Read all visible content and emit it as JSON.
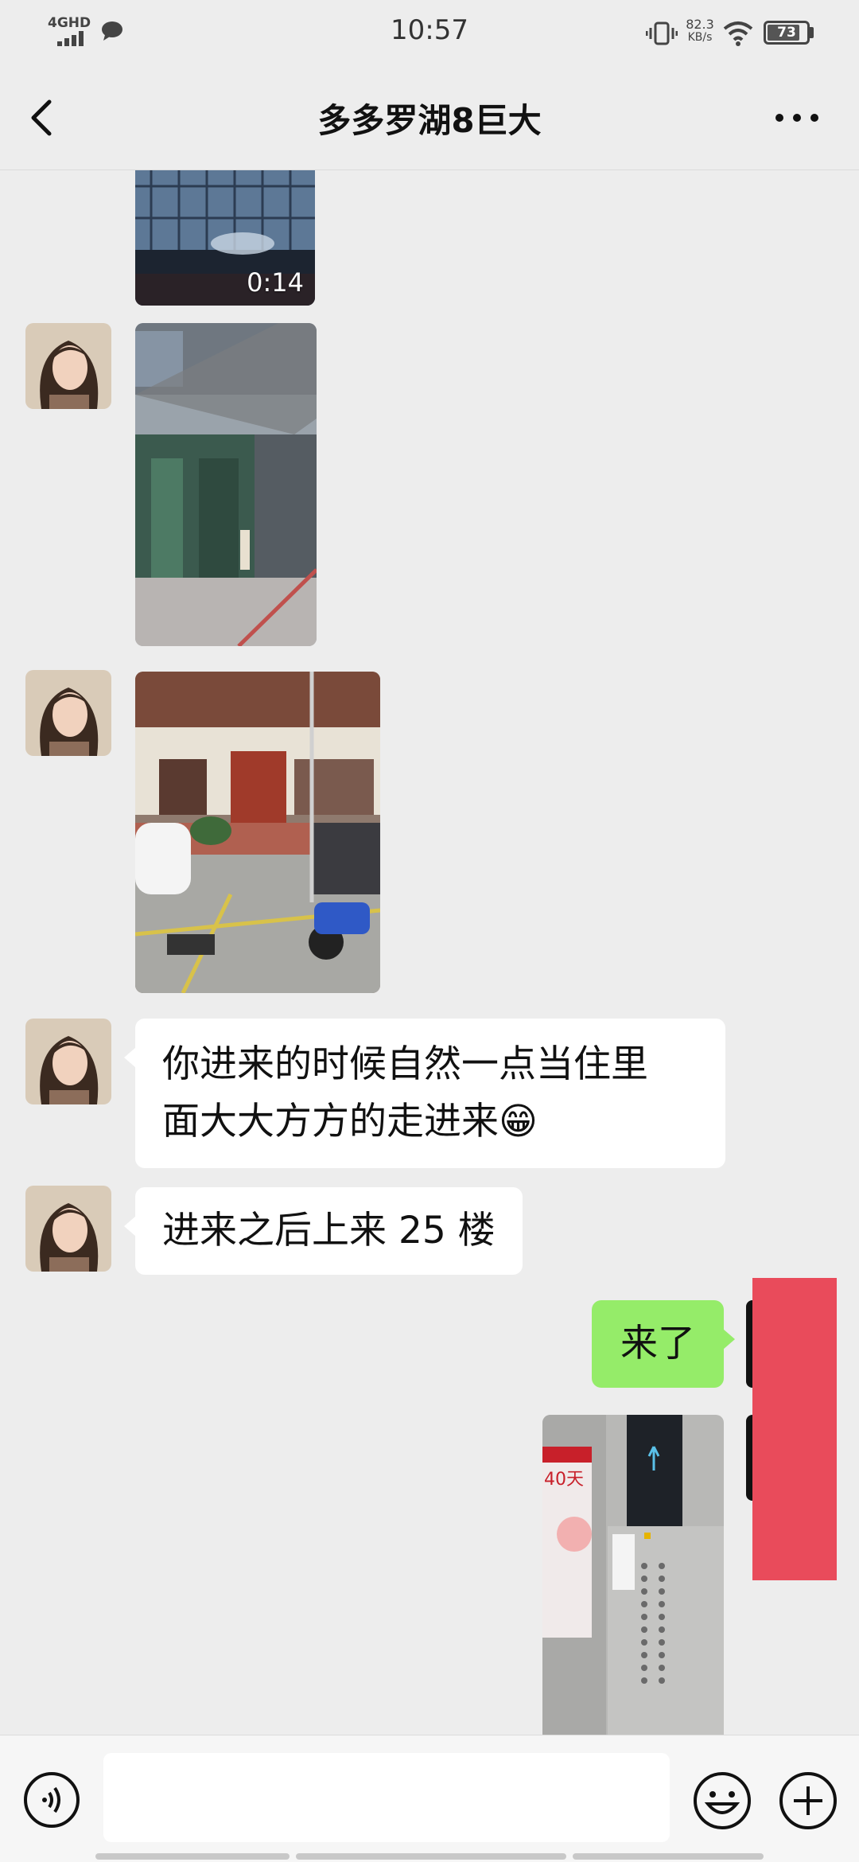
{
  "status_bar": {
    "network": "4GHD",
    "time": "10:57",
    "speed_value": "82.3",
    "speed_unit": "KB/s",
    "battery": "73"
  },
  "header": {
    "title": "多多罗湖8巨大"
  },
  "messages": [
    {
      "side": "in",
      "type": "video",
      "duration": "0:14"
    },
    {
      "side": "in",
      "type": "image",
      "subject": "building-entrance"
    },
    {
      "side": "in",
      "type": "image",
      "subject": "lobby-storefront"
    },
    {
      "side": "in",
      "type": "text",
      "line1": "你进来的时候自然一点当住里",
      "line2": "面大大方方的走进来😁"
    },
    {
      "side": "in",
      "type": "text",
      "text": "进来之后上来 25 楼"
    },
    {
      "side": "out",
      "type": "text",
      "text": "来了"
    },
    {
      "side": "out",
      "type": "image",
      "subject": "elevator-interior"
    }
  ],
  "colors": {
    "background": "#ededed",
    "incoming_bubble": "#ffffff",
    "outgoing_bubble": "#95ec69",
    "redaction": "#e94b5b"
  },
  "icons": {
    "back": "chevron-left-icon",
    "more": "more-dots-icon",
    "voice": "voice-icon",
    "emoji": "emoji-icon",
    "plus": "plus-icon"
  }
}
